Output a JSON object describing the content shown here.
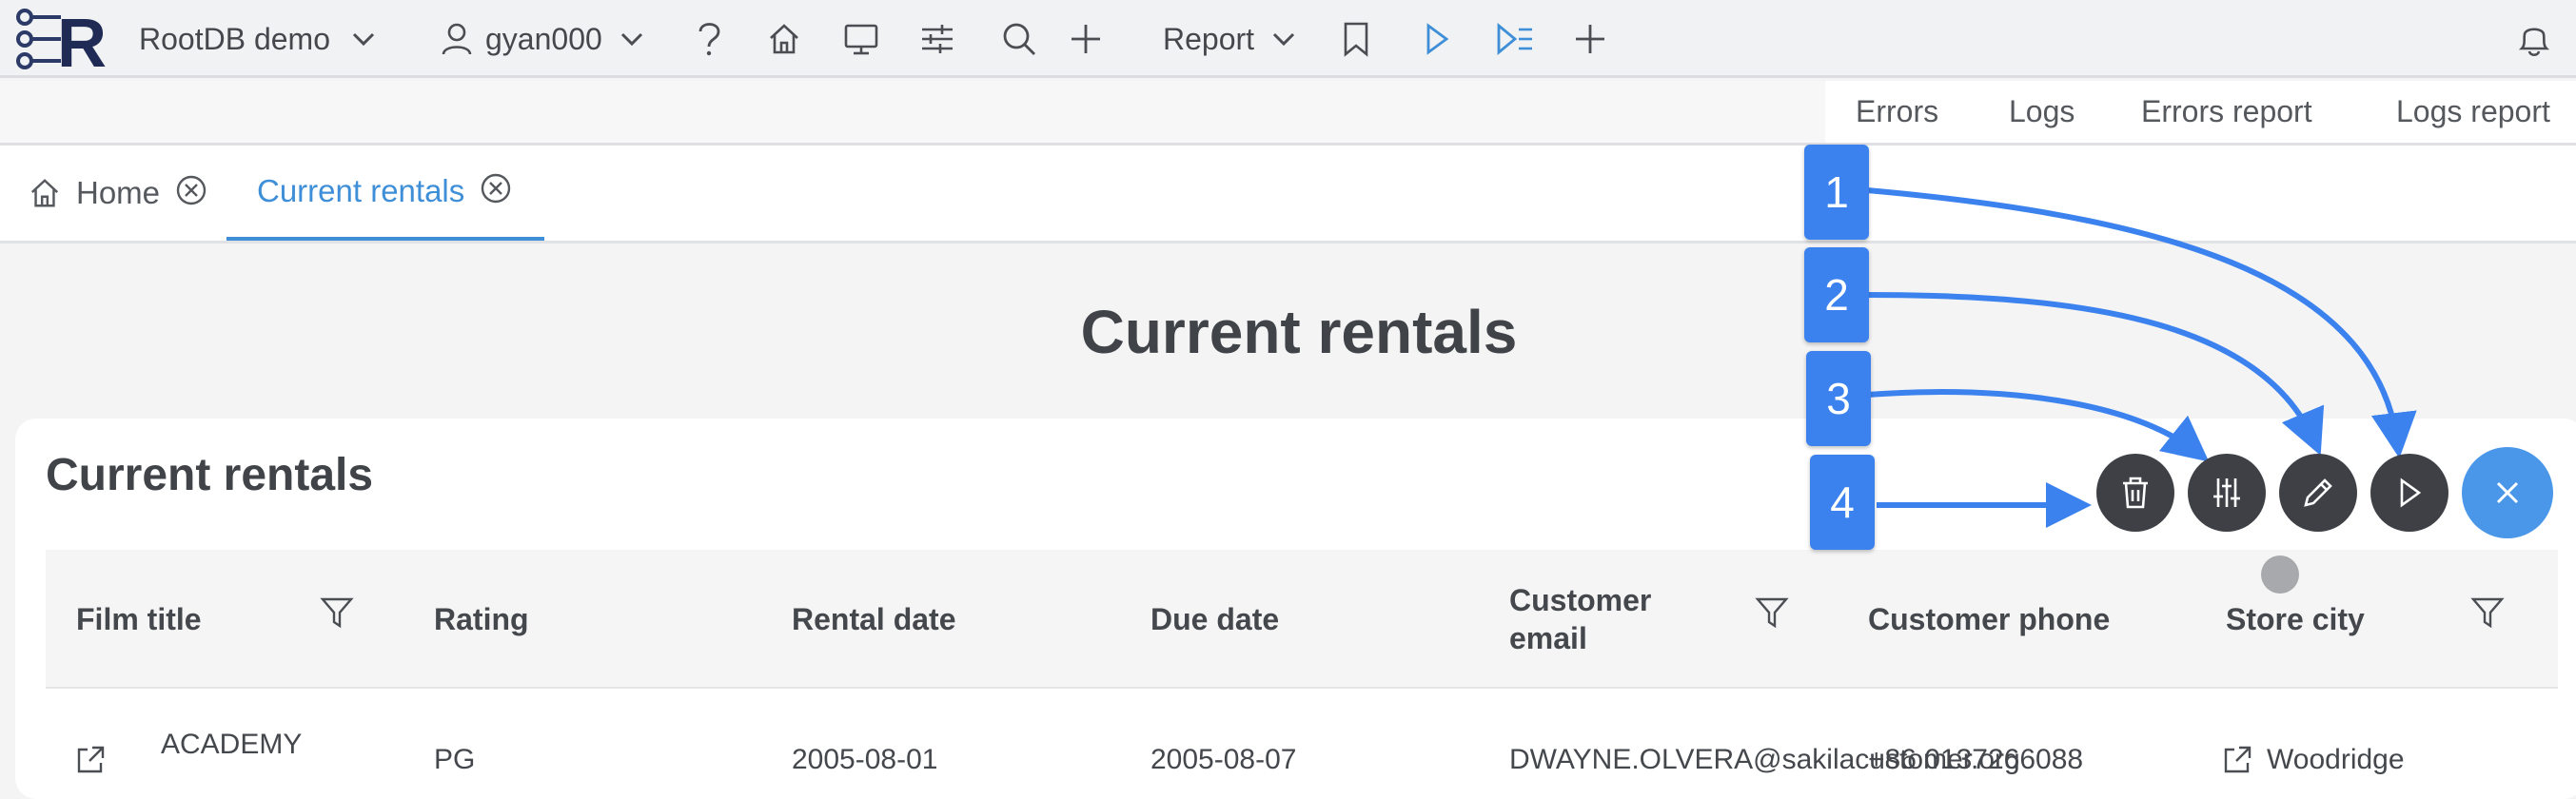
{
  "topbar": {
    "app_name": "RootDB demo",
    "user": "gyan000",
    "report_label": "Report",
    "icons": [
      "logo-r",
      "chevron-down-icon",
      "user-icon",
      "help-icon",
      "home-icon",
      "monitor-icon",
      "sliders-icon",
      "search-icon",
      "plus-icon",
      "bookmark-icon",
      "play-icon",
      "run-all-icon",
      "bell-icon"
    ]
  },
  "sublinks": [
    "Errors",
    "Logs",
    "Errors report",
    "Logs report"
  ],
  "tabs": [
    {
      "label": "Home",
      "active": false
    },
    {
      "label": "Current rentals",
      "active": true
    }
  ],
  "page": {
    "title": "Current rentals"
  },
  "card": {
    "title": "Current rentals",
    "columns": [
      "Film title",
      "Rating",
      "Rental date",
      "Due date",
      "Customer email",
      "Customer phone",
      "Store city"
    ],
    "row": [
      "ACADEMY",
      "PG",
      "2005-08-01",
      "2005-08-07",
      "DWAYNE.OLVERA@sakilacustomer.org",
      "+86 0137266088",
      "Woodridge"
    ]
  },
  "callouts": [
    "1",
    "2",
    "3",
    "4"
  ],
  "fab": {
    "actions": [
      "trash-icon",
      "sliders-icon",
      "pencil-icon",
      "play-icon"
    ],
    "main_icon": "close-icon"
  },
  "colors": {
    "accent": "#3f8fd8",
    "callout": "#3b82ef",
    "fab_dark": "#3e4045",
    "fab_main": "#4a97ea"
  }
}
